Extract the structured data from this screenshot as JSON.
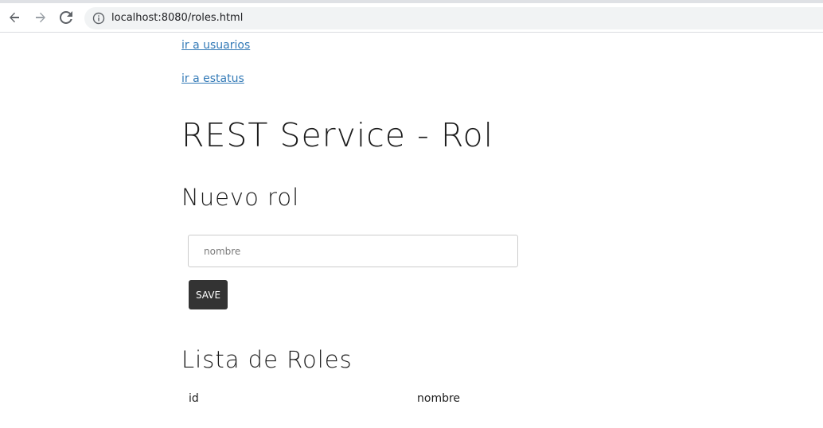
{
  "browser": {
    "url": "localhost:8080/roles.html",
    "icons": {
      "back": "back-arrow-icon",
      "forward": "forward-arrow-icon",
      "reload": "reload-icon",
      "info": "info-icon"
    }
  },
  "nav": {
    "link_usuarios": "ir a usuarios",
    "link_estatus": "ir a estatus"
  },
  "page": {
    "title": "REST Service - Rol"
  },
  "form": {
    "title": "Nuevo rol",
    "name_placeholder": "nombre",
    "name_value": "",
    "save_label": "SAVE"
  },
  "list": {
    "title": "Lista de Roles",
    "columns": [
      "id",
      "nombre"
    ],
    "rows": []
  },
  "colors": {
    "link": "#337ab7",
    "button_bg": "#333333",
    "button_text": "#ffffff"
  }
}
